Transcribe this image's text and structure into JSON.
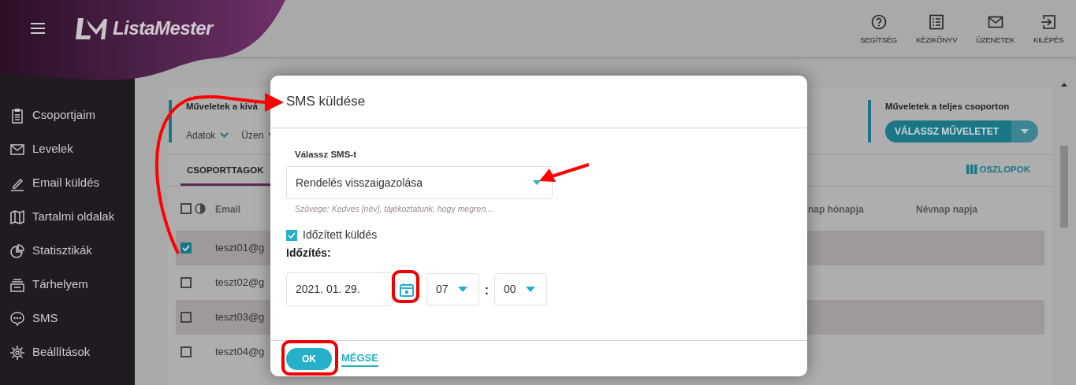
{
  "header": {
    "logo": "ListaMester",
    "actions": [
      "SEGÍTSÉG",
      "KÉZIKÖNYV",
      "ÜZENETEK",
      "KILÉPÉS"
    ]
  },
  "sidebar": {
    "items": [
      "Csoportjaim",
      "Levelek",
      "Email küldés",
      "Tartalmi oldalak",
      "Statisztikák",
      "Tárhelyem",
      "SMS",
      "Beállítások"
    ]
  },
  "card": {
    "selection_actions": {
      "title": "Műveletek a kivá",
      "menus": [
        "Adatok",
        "Üzen"
      ]
    },
    "group_actions": {
      "title": "Műveletek a teljes csoporton",
      "button": "VÁLASSZ MŰVELETET"
    },
    "tabs": [
      {
        "label": "CSOPORTTAGOK",
        "selected": true
      }
    ],
    "columns_button": "OSZLOPOK",
    "table": {
      "select_all": false,
      "columns": [
        "Email",
        "nap hónapja",
        "Névnap napja"
      ],
      "rows": [
        {
          "email": "teszt01@g",
          "checked": true
        },
        {
          "email": "teszt02@g",
          "checked": false
        },
        {
          "email": "teszt03@g",
          "checked": false
        },
        {
          "email": "teszt04@g",
          "checked": false
        }
      ]
    }
  },
  "dialog": {
    "title": "SMS küldése",
    "select_label": "Válassz SMS-t",
    "select_value": "Rendelés visszaigazolása",
    "hint": "Szövege: Kedves [név], tájékoztatunk, hogy megren...",
    "scheduled": {
      "label": "Időzített küldés",
      "checked": true
    },
    "schedule_label": "Időzítés:",
    "date": "2021. 01. 29.",
    "hour": "07",
    "separator": ":",
    "minute": "00",
    "buttons": [
      "OK",
      "MÉGSE"
    ]
  }
}
